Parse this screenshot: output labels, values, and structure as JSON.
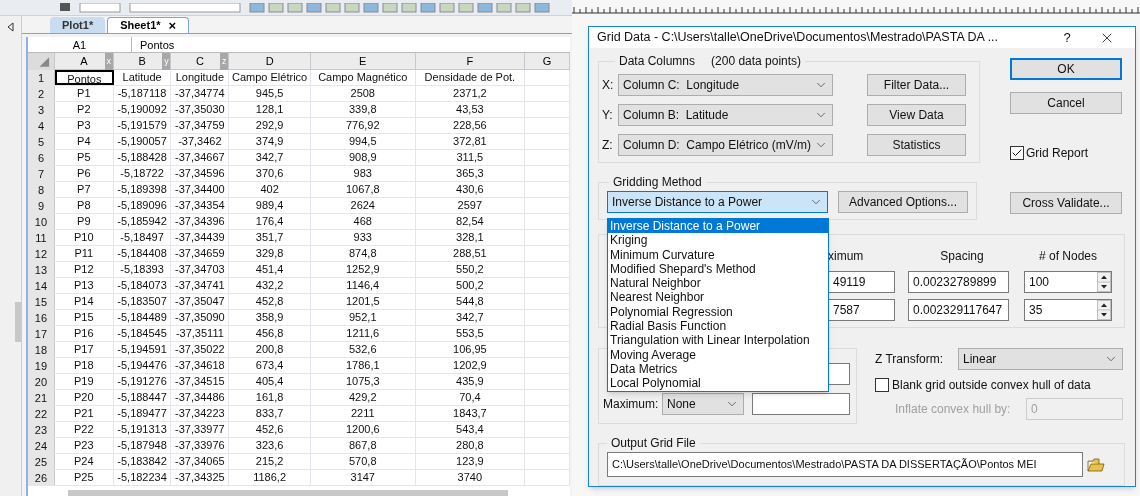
{
  "sheet": {
    "tabs": [
      {
        "label": "Plot1*",
        "selected": false
      },
      {
        "label": "Sheet1*",
        "selected": true,
        "close": "×"
      }
    ],
    "cell_ref": "A1",
    "formula": "Pontos",
    "columns": [
      {
        "label": "A",
        "tag": "x"
      },
      {
        "label": "B",
        "tag": "y"
      },
      {
        "label": "C",
        "tag": "z"
      },
      {
        "label": "D"
      },
      {
        "label": "E"
      },
      {
        "label": "F"
      },
      {
        "label": "G"
      }
    ],
    "rows": [
      {
        "number": "1",
        "selected": true,
        "cells": [
          "Pontos",
          "Latitude",
          "Longitude",
          "Campo Elétrico",
          "Campo Magnético",
          "Densidade de Pot."
        ]
      },
      {
        "number": "2",
        "selected": false,
        "cells": [
          "P1",
          "-5,187118",
          "-37,34774",
          "945,5",
          "2508",
          "2371,2"
        ]
      },
      {
        "number": "3",
        "selected": false,
        "cells": [
          "P2",
          "-5,190092",
          "-37,35030",
          "128,1",
          "339,8",
          "43,53"
        ]
      },
      {
        "number": "4",
        "selected": false,
        "cells": [
          "P3",
          "-5,191579",
          "-37,34759",
          "292,9",
          "776,92",
          "228,56"
        ]
      },
      {
        "number": "5",
        "selected": false,
        "cells": [
          "P4",
          "-5,190057",
          "-37,3462",
          "374,9",
          "994,5",
          "372,81"
        ]
      },
      {
        "number": "6",
        "selected": false,
        "cells": [
          "P5",
          "-5,188428",
          "-37,34667",
          "342,7",
          "908,9",
          "311,5"
        ]
      },
      {
        "number": "7",
        "selected": false,
        "cells": [
          "P6",
          "-5,18722",
          "-37,34596",
          "370,6",
          "983",
          "365,3"
        ]
      },
      {
        "number": "8",
        "selected": false,
        "cells": [
          "P7",
          "-5,189398",
          "-37,34400",
          "402",
          "1067,8",
          "430,6"
        ]
      },
      {
        "number": "9",
        "selected": false,
        "cells": [
          "P8",
          "-5,189096",
          "-37,34354",
          "989,4",
          "2624",
          "2597"
        ]
      },
      {
        "number": "10",
        "selected": false,
        "cells": [
          "P9",
          "-5,185942",
          "-37,34396",
          "176,4",
          "468",
          "82,54"
        ]
      },
      {
        "number": "11",
        "selected": false,
        "cells": [
          "P10",
          "-5,18497",
          "-37,34439",
          "351,7",
          "933",
          "328,1"
        ]
      },
      {
        "number": "12",
        "selected": false,
        "cells": [
          "P11",
          "-5,184408",
          "-37,34659",
          "329,8",
          "874,8",
          "288,51"
        ]
      },
      {
        "number": "13",
        "selected": false,
        "cells": [
          "P12",
          "-5,18393",
          "-37,34703",
          "451,4",
          "1252,9",
          "550,2"
        ]
      },
      {
        "number": "14",
        "selected": false,
        "cells": [
          "P13",
          "-5,184073",
          "-37,34741",
          "432,2",
          "1146,4",
          "500,2"
        ]
      },
      {
        "number": "15",
        "selected": false,
        "cells": [
          "P14",
          "-5,183507",
          "-37,35047",
          "452,8",
          "1201,5",
          "544,8"
        ]
      },
      {
        "number": "16",
        "selected": false,
        "cells": [
          "P15",
          "-5,184489",
          "-37,35090",
          "358,9",
          "952,1",
          "342,7"
        ]
      },
      {
        "number": "17",
        "selected": false,
        "cells": [
          "P16",
          "-5,184545",
          "-37,35111",
          "456,8",
          "1211,6",
          "553,5"
        ]
      },
      {
        "number": "18",
        "selected": false,
        "cells": [
          "P17",
          "-5,194591",
          "-37,35022",
          "200,8",
          "532,6",
          "106,95"
        ]
      },
      {
        "number": "19",
        "selected": false,
        "cells": [
          "P18",
          "-5,194476",
          "-37,34618",
          "673,4",
          "1786,1",
          "1202,9"
        ]
      },
      {
        "number": "20",
        "selected": false,
        "cells": [
          "P19",
          "-5,191276",
          "-37,34515",
          "405,4",
          "1075,3",
          "435,9"
        ]
      },
      {
        "number": "21",
        "selected": false,
        "cells": [
          "P20",
          "-5,188447",
          "-37,34486",
          "161,8",
          "429,2",
          "70,4"
        ]
      },
      {
        "number": "22",
        "selected": false,
        "cells": [
          "P21",
          "-5,189477",
          "-37,34223",
          "833,7",
          "2211",
          "1843,7"
        ]
      },
      {
        "number": "23",
        "selected": false,
        "cells": [
          "P22",
          "-5,191313",
          "-37,33977",
          "452,6",
          "1200,6",
          "543,4"
        ]
      },
      {
        "number": "24",
        "selected": false,
        "cells": [
          "P23",
          "-5,187948",
          "-37,33976",
          "323,6",
          "867,8",
          "280,8"
        ]
      },
      {
        "number": "25",
        "selected": false,
        "cells": [
          "P24",
          "-5,183842",
          "-37,34065",
          "215,2",
          "570,8",
          "123,9"
        ]
      },
      {
        "number": "26",
        "selected": false,
        "cells": [
          "P25",
          "-5,182234",
          "-37,34325",
          "1186,2",
          "3147",
          "3740"
        ]
      }
    ]
  },
  "dialog": {
    "title": "Grid Data - C:\\Users\\talle\\OneDrive\\Documentos\\Mestrado\\PASTA DA ...",
    "help": "?",
    "data_columns": {
      "label": "Data Columns",
      "count": "(200 data points)",
      "axes": [
        {
          "axis": "X:",
          "value": "Column C:  Longitude"
        },
        {
          "axis": "Y:",
          "value": "Column B:  Latitude"
        },
        {
          "axis": "Z:",
          "value": "Column D:  Campo Elétrico (mV/m)"
        }
      ],
      "buttons": [
        "Filter Data...",
        "View Data",
        "Statistics"
      ]
    },
    "actions": [
      {
        "label": "OK",
        "default": true
      },
      {
        "label": "Cancel",
        "default": false
      }
    ],
    "grid_report": {
      "label": "Grid Report",
      "checked": true
    },
    "gridding_method": {
      "label": "Gridding Method",
      "value": "Inverse Distance to a Power",
      "expanded": true,
      "options": [
        {
          "label": "Inverse Distance to a Power",
          "selected": true
        },
        {
          "label": "Kriging",
          "selected": false
        },
        {
          "label": "Minimum Curvature",
          "selected": false
        },
        {
          "label": "Modified Shepard's Method",
          "selected": false
        },
        {
          "label": "Natural Neighbor",
          "selected": false
        },
        {
          "label": "Nearest Neighbor",
          "selected": false
        },
        {
          "label": "Polynomial Regression",
          "selected": false
        },
        {
          "label": "Radial Basis Function",
          "selected": false
        },
        {
          "label": "Triangulation with Linear Interpolation",
          "selected": false
        },
        {
          "label": "Moving Average",
          "selected": false
        },
        {
          "label": "Data Metrics",
          "selected": false
        },
        {
          "label": "Local Polynomial",
          "selected": false
        }
      ],
      "advanced": "Advanced Options...",
      "cross_validate": "Cross Validate..."
    },
    "geometry": {
      "headers": [
        "ximum",
        "Spacing",
        "# of Nodes"
      ],
      "rows": [
        {
          "maximum": "49119",
          "spacing": "0.00232789899",
          "nodes": "100"
        },
        {
          "maximum": "7587",
          "spacing": "0.002329117647",
          "nodes": "35"
        }
      ]
    },
    "filter": {
      "maximum_label": "Maximum:",
      "maximum_value": "None"
    },
    "z_transform": {
      "label": "Z Transform:",
      "value": "Linear"
    },
    "blank_grid": {
      "label": "Blank grid outside convex hull of data",
      "checked": false
    },
    "inflate": {
      "label": "Inflate convex hull by:",
      "value": "0",
      "disabled": true
    },
    "output": {
      "label": "Output Grid File",
      "path": "C:\\Users\\talle\\OneDrive\\Documentos\\Mestrado\\PASTA DA DISSERTAÇÃO\\Pontos MEI"
    }
  }
}
